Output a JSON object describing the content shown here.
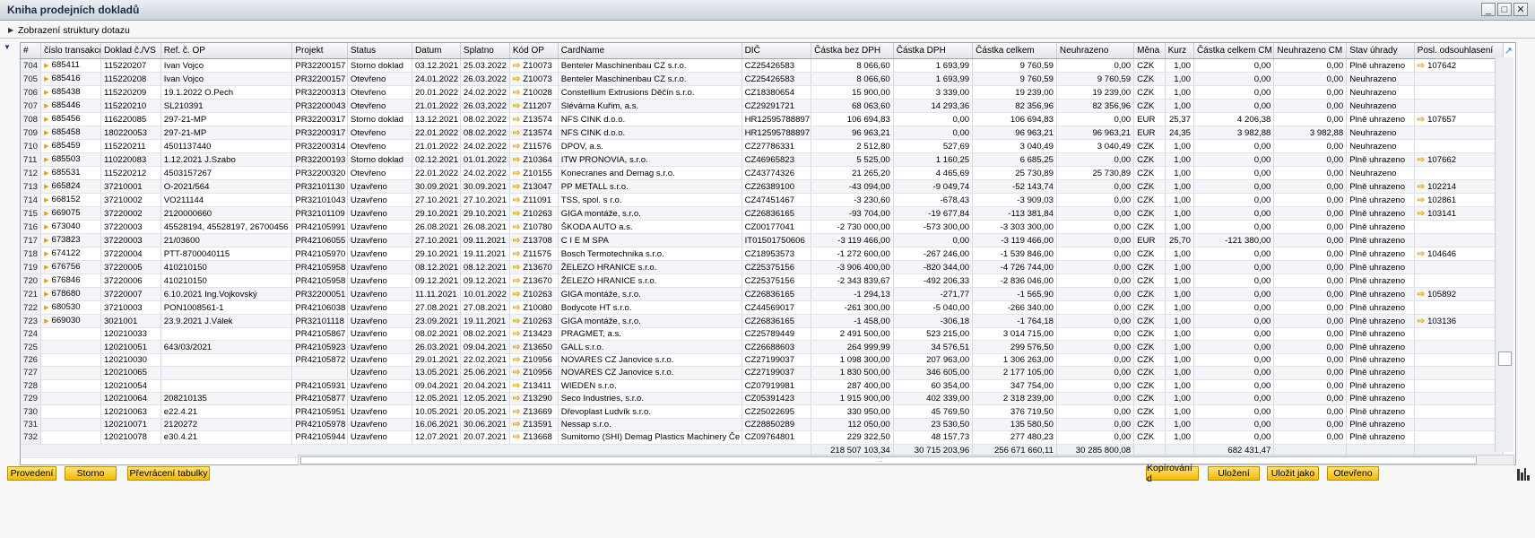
{
  "window": {
    "title": "Kniha prodejních dokladů",
    "buttons": [
      "_",
      "□",
      "✕"
    ]
  },
  "query_bar": {
    "label": "Zobrazení struktury dotazu"
  },
  "columns": [
    "#",
    "číslo transakce",
    "Doklad č./VS",
    "Ref. č. OP",
    "Projekt",
    "Status",
    "Datum",
    "Splatno",
    "Kód OP",
    "CardName",
    "DIČ",
    "Částka bez DPH",
    "Částka DPH",
    "Částka celkem",
    "Neuhrazeno",
    "Měna",
    "Kurz",
    "Částka celkem CM",
    "Neuhrazeno CM",
    "Stav úhrady",
    "Posl. odsouhlasení"
  ],
  "rows": [
    {
      "n": "704",
      "trans": "685411",
      "doc": "115220207",
      "ref": "Ivan Vojco",
      "proj": "PR32200157",
      "status": "Storno doklad",
      "date": "03.12.2021",
      "due": "25.03.2022",
      "code": "Z10073",
      "card": "Benteler Maschinenbau CZ s.r.o.",
      "dic": "CZ25426583",
      "base": "8 066,60",
      "vat": "1 693,99",
      "total": "9 760,59",
      "unpaid": "0,00",
      "cur": "CZK",
      "rate": "1,00",
      "totfc": "0,00",
      "unpaidfc": "0,00",
      "state": "Plně uhrazeno",
      "recon": "107642"
    },
    {
      "n": "705",
      "trans": "685416",
      "doc": "115220208",
      "ref": "Ivan Vojco",
      "proj": "PR32200157",
      "status": "Otevřeno",
      "date": "24.01.2022",
      "due": "26.03.2022",
      "code": "Z10073",
      "card": "Benteler Maschinenbau CZ s.r.o.",
      "dic": "CZ25426583",
      "base": "8 066,60",
      "vat": "1 693,99",
      "total": "9 760,59",
      "unpaid": "9 760,59",
      "cur": "CZK",
      "rate": "1,00",
      "totfc": "0,00",
      "unpaidfc": "0,00",
      "state": "Neuhrazeno",
      "recon": ""
    },
    {
      "n": "706",
      "trans": "685438",
      "doc": "115220209",
      "ref": "19.1.2022 O.Pech",
      "proj": "PR32200313",
      "status": "Otevřeno",
      "date": "20.01.2022",
      "due": "24.02.2022",
      "code": "Z10028",
      "card": "Constellium Extrusions Děčín s.r.o.",
      "dic": "CZ18380654",
      "base": "15 900,00",
      "vat": "3 339,00",
      "total": "19 239,00",
      "unpaid": "19 239,00",
      "cur": "CZK",
      "rate": "1,00",
      "totfc": "0,00",
      "unpaidfc": "0,00",
      "state": "Neuhrazeno",
      "recon": ""
    },
    {
      "n": "707",
      "trans": "685446",
      "doc": "115220210",
      "ref": "SL210391",
      "proj": "PR32200043",
      "status": "Otevřeno",
      "date": "21.01.2022",
      "due": "26.03.2022",
      "code": "Z11207",
      "card": "Slévárna Kuřim, a.s.",
      "dic": "CZ29291721",
      "base": "68 063,60",
      "vat": "14 293,36",
      "total": "82 356,96",
      "unpaid": "82 356,96",
      "cur": "CZK",
      "rate": "1,00",
      "totfc": "0,00",
      "unpaidfc": "0,00",
      "state": "Neuhrazeno",
      "recon": ""
    },
    {
      "n": "708",
      "trans": "685456",
      "doc": "116220085",
      "ref": "297-21-MP",
      "proj": "PR32200317",
      "status": "Storno doklad",
      "date": "13.12.2021",
      "due": "08.02.2022",
      "code": "Z13574",
      "card": "NFS CINK d.o.o.",
      "dic": "HR12595788897",
      "base": "106 694,83",
      "vat": "0,00",
      "total": "106 694,83",
      "unpaid": "0,00",
      "cur": "EUR",
      "rate": "25,37",
      "totfc": "4 206,38",
      "unpaidfc": "0,00",
      "state": "Plně uhrazeno",
      "recon": "107657"
    },
    {
      "n": "709",
      "trans": "685458",
      "doc": "180220053",
      "ref": "297-21-MP",
      "proj": "PR32200317",
      "status": "Otevřeno",
      "date": "22.01.2022",
      "due": "08.02.2022",
      "code": "Z13574",
      "card": "NFS CINK d.o.o.",
      "dic": "HR12595788897",
      "base": "96 963,21",
      "vat": "0,00",
      "total": "96 963,21",
      "unpaid": "96 963,21",
      "cur": "EUR",
      "rate": "24,35",
      "totfc": "3 982,88",
      "unpaidfc": "3 982,88",
      "state": "Neuhrazeno",
      "recon": ""
    },
    {
      "n": "710",
      "trans": "685459",
      "doc": "115220211",
      "ref": "4501137440",
      "proj": "PR32200314",
      "status": "Otevřeno",
      "date": "21.01.2022",
      "due": "24.02.2022",
      "code": "Z11576",
      "card": "DPOV, a.s.",
      "dic": "CZ27786331",
      "base": "2 512,80",
      "vat": "527,69",
      "total": "3 040,49",
      "unpaid": "3 040,49",
      "cur": "CZK",
      "rate": "1,00",
      "totfc": "0,00",
      "unpaidfc": "0,00",
      "state": "Neuhrazeno",
      "recon": ""
    },
    {
      "n": "711",
      "trans": "685503",
      "doc": "110220083",
      "ref": "1.12.2021 J.Szabo",
      "proj": "PR32200193",
      "status": "Storno doklad",
      "date": "02.12.2021",
      "due": "01.01.2022",
      "code": "Z10364",
      "card": "ITW PRONOVIA, s.r.o.",
      "dic": "CZ46965823",
      "base": "5 525,00",
      "vat": "1 160,25",
      "total": "6 685,25",
      "unpaid": "0,00",
      "cur": "CZK",
      "rate": "1,00",
      "totfc": "0,00",
      "unpaidfc": "0,00",
      "state": "Plně uhrazeno",
      "recon": "107662"
    },
    {
      "n": "712",
      "trans": "685531",
      "doc": "115220212",
      "ref": "4503157267",
      "proj": "PR32200320",
      "status": "Otevřeno",
      "date": "22.01.2022",
      "due": "24.02.2022",
      "code": "Z10155",
      "card": "Konecranes and Demag s.r.o.",
      "dic": "CZ43774326",
      "base": "21 265,20",
      "vat": "4 465,69",
      "total": "25 730,89",
      "unpaid": "25 730,89",
      "cur": "CZK",
      "rate": "1,00",
      "totfc": "0,00",
      "unpaidfc": "0,00",
      "state": "Neuhrazeno",
      "recon": ""
    },
    {
      "n": "713",
      "trans": "665824",
      "doc": "37210001",
      "ref": "O-2021/564",
      "proj": "PR32101130",
      "status": "Uzavřeno",
      "date": "30.09.2021",
      "due": "30.09.2021",
      "code": "Z13047",
      "card": "PP METALL s.r.o.",
      "dic": "CZ26389100",
      "base": "-43 094,00",
      "vat": "-9 049,74",
      "total": "-52 143,74",
      "unpaid": "0,00",
      "cur": "CZK",
      "rate": "1,00",
      "totfc": "0,00",
      "unpaidfc": "0,00",
      "state": "Plně uhrazeno",
      "recon": "102214"
    },
    {
      "n": "714",
      "trans": "668152",
      "doc": "37210002",
      "ref": "VO211144",
      "proj": "PR32101043",
      "status": "Uzavřeno",
      "date": "27.10.2021",
      "due": "27.10.2021",
      "code": "Z11091",
      "card": "TSS, spol. s r.o.",
      "dic": "CZ47451467",
      "base": "-3 230,60",
      "vat": "-678,43",
      "total": "-3 909,03",
      "unpaid": "0,00",
      "cur": "CZK",
      "rate": "1,00",
      "totfc": "0,00",
      "unpaidfc": "0,00",
      "state": "Plně uhrazeno",
      "recon": "102861"
    },
    {
      "n": "715",
      "trans": "669075",
      "doc": "37220002",
      "ref": "2120000660",
      "proj": "PR32101109",
      "status": "Uzavřeno",
      "date": "29.10.2021",
      "due": "29.10.2021",
      "code": "Z10263",
      "card": "GIGA montáže, s.r.o.",
      "dic": "CZ26836165",
      "base": "-93 704,00",
      "vat": "-19 677,84",
      "total": "-113 381,84",
      "unpaid": "0,00",
      "cur": "CZK",
      "rate": "1,00",
      "totfc": "0,00",
      "unpaidfc": "0,00",
      "state": "Plně uhrazeno",
      "recon": "103141"
    },
    {
      "n": "716",
      "trans": "673040",
      "doc": "37220003",
      "ref": "45528194, 45528197, 26700456",
      "proj": "PR42105991",
      "status": "Uzavřeno",
      "date": "26.08.2021",
      "due": "26.08.2021",
      "code": "Z10780",
      "card": "ŠKODA AUTO a.s.",
      "dic": "CZ00177041",
      "base": "-2 730 000,00",
      "vat": "-573 300,00",
      "total": "-3 303 300,00",
      "unpaid": "0,00",
      "cur": "CZK",
      "rate": "1,00",
      "totfc": "0,00",
      "unpaidfc": "0,00",
      "state": "Plně uhrazeno",
      "recon": ""
    },
    {
      "n": "717",
      "trans": "673823",
      "doc": "37220003",
      "ref": "21/03600",
      "proj": "PR42106055",
      "status": "Uzavřeno",
      "date": "27.10.2021",
      "due": "09.11.2021",
      "code": "Z13708",
      "card": "C I E M SPA",
      "dic": "IT01501750606",
      "base": "-3 119 466,00",
      "vat": "0,00",
      "total": "-3 119 466,00",
      "unpaid": "0,00",
      "cur": "EUR",
      "rate": "25,70",
      "totfc": "-121 380,00",
      "unpaidfc": "0,00",
      "state": "Plně uhrazeno",
      "recon": ""
    },
    {
      "n": "718",
      "trans": "674122",
      "doc": "37220004",
      "ref": "PTT-8700040115",
      "proj": "PR42105970",
      "status": "Uzavřeno",
      "date": "29.10.2021",
      "due": "19.11.2021",
      "code": "Z11575",
      "card": "Bosch Termotechnika s.r.o.",
      "dic": "CZ18953573",
      "base": "-1 272 600,00",
      "vat": "-267 246,00",
      "total": "-1 539 846,00",
      "unpaid": "0,00",
      "cur": "CZK",
      "rate": "1,00",
      "totfc": "0,00",
      "unpaidfc": "0,00",
      "state": "Plně uhrazeno",
      "recon": "104646"
    },
    {
      "n": "719",
      "trans": "676756",
      "doc": "37220005",
      "ref": "410210150",
      "proj": "PR42105958",
      "status": "Uzavřeno",
      "date": "08.12.2021",
      "due": "08.12.2021",
      "code": "Z13670",
      "card": "ŽELEZO HRANICE s.r.o.",
      "dic": "CZ25375156",
      "base": "-3 906 400,00",
      "vat": "-820 344,00",
      "total": "-4 726 744,00",
      "unpaid": "0,00",
      "cur": "CZK",
      "rate": "1,00",
      "totfc": "0,00",
      "unpaidfc": "0,00",
      "state": "Plně uhrazeno",
      "recon": ""
    },
    {
      "n": "720",
      "trans": "676846",
      "doc": "37220006",
      "ref": "410210150",
      "proj": "PR42105958",
      "status": "Uzavřeno",
      "date": "09.12.2021",
      "due": "09.12.2021",
      "code": "Z13670",
      "card": "ŽELEZO HRANICE s.r.o.",
      "dic": "CZ25375156",
      "base": "-2 343 839,67",
      "vat": "-492 206,33",
      "total": "-2 836 046,00",
      "unpaid": "0,00",
      "cur": "CZK",
      "rate": "1,00",
      "totfc": "0,00",
      "unpaidfc": "0,00",
      "state": "Plně uhrazeno",
      "recon": ""
    },
    {
      "n": "721",
      "trans": "678680",
      "doc": "37220007",
      "ref": "6.10.2021 Ing.Vojkovský",
      "proj": "PR32200051",
      "status": "Uzavřeno",
      "date": "11.11.2021",
      "due": "10.01.2022",
      "code": "Z10263",
      "card": "GIGA montáže, s.r.o.",
      "dic": "CZ26836165",
      "base": "-1 294,13",
      "vat": "-271,77",
      "total": "-1 565,90",
      "unpaid": "0,00",
      "cur": "CZK",
      "rate": "1,00",
      "totfc": "0,00",
      "unpaidfc": "0,00",
      "state": "Plně uhrazeno",
      "recon": "105892"
    },
    {
      "n": "722",
      "trans": "680530",
      "doc": "37210003",
      "ref": "PON1008561-1",
      "proj": "PR42106038",
      "status": "Uzavřeno",
      "date": "27.08.2021",
      "due": "27.08.2021",
      "code": "Z10080",
      "card": "Bodycote HT s.r.o.",
      "dic": "CZ44569017",
      "base": "-261 300,00",
      "vat": "-5 040,00",
      "total": "-266 340,00",
      "unpaid": "0,00",
      "cur": "CZK",
      "rate": "1,00",
      "totfc": "0,00",
      "unpaidfc": "0,00",
      "state": "Plně uhrazeno",
      "recon": ""
    },
    {
      "n": "723",
      "trans": "669030",
      "doc": "3021001",
      "ref": "23.9.2021 J.Válek",
      "proj": "PR32101118",
      "status": "Uzavřeno",
      "date": "23.09.2021",
      "due": "19.11.2021",
      "code": "Z10263",
      "card": "GIGA montáže, s.r.o.",
      "dic": "CZ26836165",
      "base": "-1 458,00",
      "vat": "-306,18",
      "total": "-1 764,18",
      "unpaid": "0,00",
      "cur": "CZK",
      "rate": "1,00",
      "totfc": "0,00",
      "unpaidfc": "0,00",
      "state": "Plně uhrazeno",
      "recon": "103136"
    },
    {
      "n": "724",
      "trans": "",
      "doc": "120210033",
      "ref": "",
      "proj": "PR42105867",
      "status": "Uzavřeno",
      "date": "08.02.2021",
      "due": "08.02.2021",
      "code": "Z13423",
      "card": "PRAGMET, a.s.",
      "dic": "CZ25789449",
      "base": "2 491 500,00",
      "vat": "523 215,00",
      "total": "3 014 715,00",
      "unpaid": "0,00",
      "cur": "CZK",
      "rate": "1,00",
      "totfc": "0,00",
      "unpaidfc": "0,00",
      "state": "Plně uhrazeno",
      "recon": ""
    },
    {
      "n": "725",
      "trans": "",
      "doc": "120210051",
      "ref": "643/03/2021",
      "proj": "PR42105923",
      "status": "Uzavřeno",
      "date": "26.03.2021",
      "due": "09.04.2021",
      "code": "Z13650",
      "card": "GALL s.r.o.",
      "dic": "CZ26688603",
      "base": "264 999,99",
      "vat": "34 576,51",
      "total": "299 576,50",
      "unpaid": "0,00",
      "cur": "CZK",
      "rate": "1,00",
      "totfc": "0,00",
      "unpaidfc": "0,00",
      "state": "Plně uhrazeno",
      "recon": ""
    },
    {
      "n": "726",
      "trans": "",
      "doc": "120210030",
      "ref": "",
      "proj": "PR42105872",
      "status": "Uzavřeno",
      "date": "29.01.2021",
      "due": "22.02.2021",
      "code": "Z10956",
      "card": "NOVARES CZ Janovice s.r.o.",
      "dic": "CZ27199037",
      "base": "1 098 300,00",
      "vat": "207 963,00",
      "total": "1 306 263,00",
      "unpaid": "0,00",
      "cur": "CZK",
      "rate": "1,00",
      "totfc": "0,00",
      "unpaidfc": "0,00",
      "state": "Plně uhrazeno",
      "recon": ""
    },
    {
      "n": "727",
      "trans": "",
      "doc": "120210065",
      "ref": "",
      "proj": "",
      "status": "Uzavřeno",
      "date": "13.05.2021",
      "due": "25.06.2021",
      "code": "Z10956",
      "card": "NOVARES CZ Janovice s.r.o.",
      "dic": "CZ27199037",
      "base": "1 830 500,00",
      "vat": "346 605,00",
      "total": "2 177 105,00",
      "unpaid": "0,00",
      "cur": "CZK",
      "rate": "1,00",
      "totfc": "0,00",
      "unpaidfc": "0,00",
      "state": "Plně uhrazeno",
      "recon": ""
    },
    {
      "n": "728",
      "trans": "",
      "doc": "120210054",
      "ref": "",
      "proj": "PR42105931",
      "status": "Uzavřeno",
      "date": "09.04.2021",
      "due": "20.04.2021",
      "code": "Z13411",
      "card": "WIEDEN s.r.o.",
      "dic": "CZ07919981",
      "base": "287 400,00",
      "vat": "60 354,00",
      "total": "347 754,00",
      "unpaid": "0,00",
      "cur": "CZK",
      "rate": "1,00",
      "totfc": "0,00",
      "unpaidfc": "0,00",
      "state": "Plně uhrazeno",
      "recon": ""
    },
    {
      "n": "729",
      "trans": "",
      "doc": "120210064",
      "ref": "208210135",
      "proj": "PR42105877",
      "status": "Uzavřeno",
      "date": "12.05.2021",
      "due": "12.05.2021",
      "code": "Z13290",
      "card": "Seco Industries, s.r.o.",
      "dic": "CZ05391423",
      "base": "1 915 900,00",
      "vat": "402 339,00",
      "total": "2 318 239,00",
      "unpaid": "0,00",
      "cur": "CZK",
      "rate": "1,00",
      "totfc": "0,00",
      "unpaidfc": "0,00",
      "state": "Plně uhrazeno",
      "recon": ""
    },
    {
      "n": "730",
      "trans": "",
      "doc": "120210063",
      "ref": "e22.4.21",
      "proj": "PR42105951",
      "status": "Uzavřeno",
      "date": "10.05.2021",
      "due": "20.05.2021",
      "code": "Z13669",
      "card": "Dřevoplast Ludvík s.r.o.",
      "dic": "CZ25022695",
      "base": "330 950,00",
      "vat": "45 769,50",
      "total": "376 719,50",
      "unpaid": "0,00",
      "cur": "CZK",
      "rate": "1,00",
      "totfc": "0,00",
      "unpaidfc": "0,00",
      "state": "Plně uhrazeno",
      "recon": ""
    },
    {
      "n": "731",
      "trans": "",
      "doc": "120210071",
      "ref": "2120272",
      "proj": "PR42105978",
      "status": "Uzavřeno",
      "date": "16.06.2021",
      "due": "30.06.2021",
      "code": "Z13591",
      "card": "Nessap s.r.o.",
      "dic": "CZ28850289",
      "base": "112 050,00",
      "vat": "23 530,50",
      "total": "135 580,50",
      "unpaid": "0,00",
      "cur": "CZK",
      "rate": "1,00",
      "totfc": "0,00",
      "unpaidfc": "0,00",
      "state": "Plně uhrazeno",
      "recon": ""
    },
    {
      "n": "732",
      "trans": "",
      "doc": "120210078",
      "ref": "e30.4.21",
      "proj": "PR42105944",
      "status": "Uzavřeno",
      "date": "12.07.2021",
      "due": "20.07.2021",
      "code": "Z13668",
      "card": "Sumitomo (SHI) Demag Plastics Machinery Če",
      "dic": "CZ09764801",
      "base": "229 322,50",
      "vat": "48 157,73",
      "total": "277 480,23",
      "unpaid": "0,00",
      "cur": "CZK",
      "rate": "1,00",
      "totfc": "0,00",
      "unpaidfc": "0,00",
      "state": "Plně uhrazeno",
      "recon": ""
    }
  ],
  "totals": {
    "base": "218 507 103,34",
    "vat": "30 715 203,96",
    "total": "256 671 660,11",
    "unpaid": "30 285 800,08",
    "totfc": "682 431,47"
  },
  "buttons": {
    "run": "Provedení",
    "cancel": "Storno",
    "pivot": "Převrácení tabulky",
    "copy": "Kopírování d",
    "save": "Uložení",
    "save_as": "Uložit jako",
    "open": "Otevřeno"
  },
  "icons": {
    "expand": "link-arrow-icon",
    "chart": "bar-chart-icon"
  },
  "colors": {
    "button_fill": "#f5b900",
    "link_arrow": "#e6a100",
    "title_text": "#1b2a44"
  }
}
